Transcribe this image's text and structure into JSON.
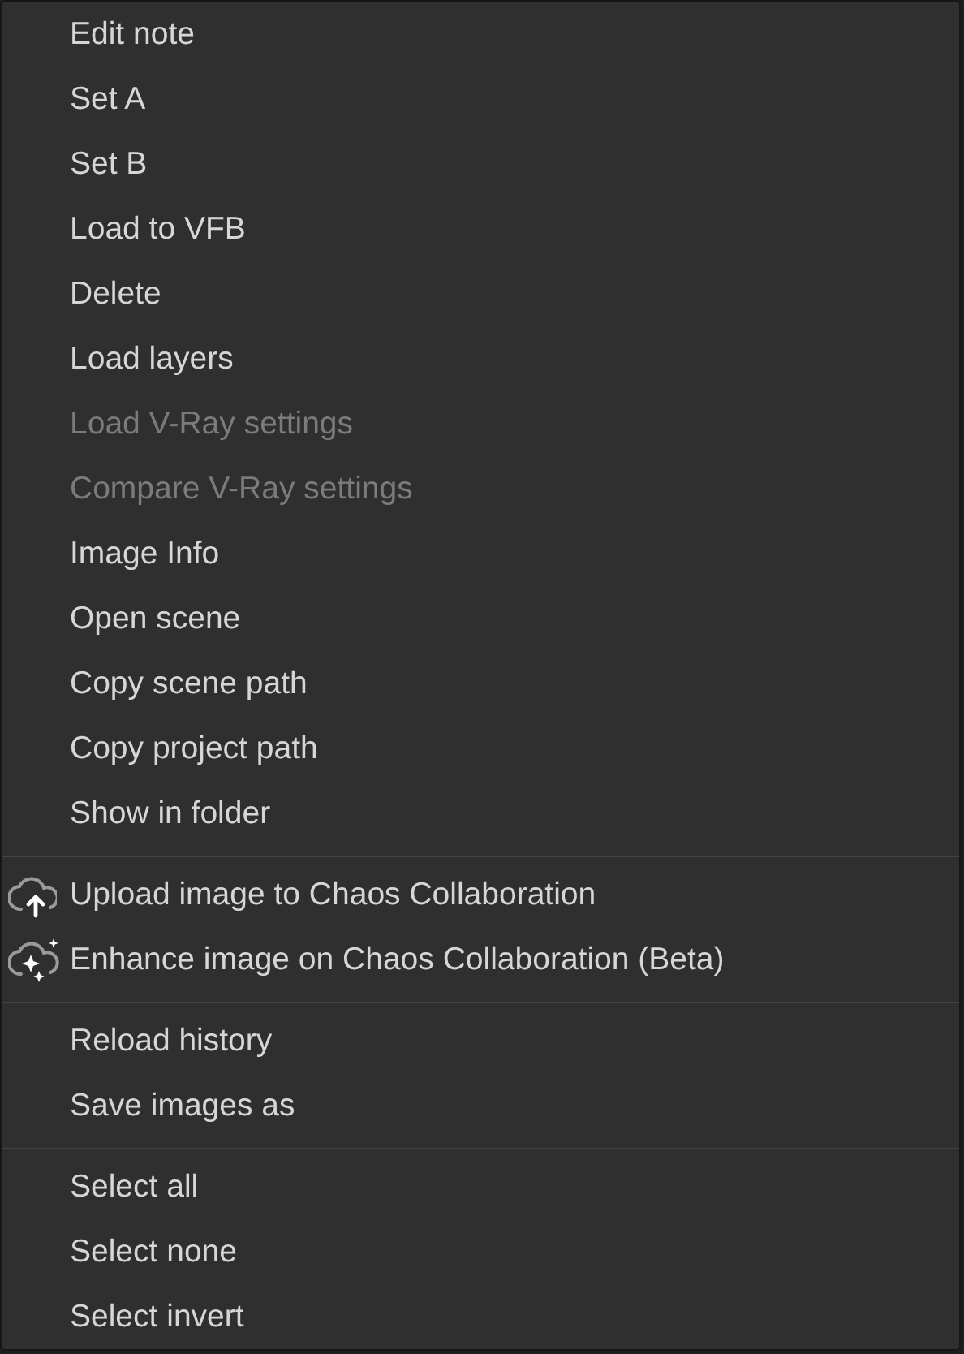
{
  "menu": {
    "sections": [
      {
        "items": [
          {
            "label": "Edit note",
            "disabled": false
          },
          {
            "label": "Set A",
            "disabled": false
          },
          {
            "label": "Set B",
            "disabled": false
          },
          {
            "label": "Load to VFB",
            "disabled": false
          },
          {
            "label": "Delete",
            "disabled": false
          },
          {
            "label": "Load layers",
            "disabled": false
          },
          {
            "label": "Load V-Ray settings",
            "disabled": true
          },
          {
            "label": "Compare V-Ray settings",
            "disabled": true
          },
          {
            "label": "Image Info",
            "disabled": false
          },
          {
            "label": "Open scene",
            "disabled": false
          },
          {
            "label": "Copy scene path",
            "disabled": false
          },
          {
            "label": "Copy project path",
            "disabled": false
          },
          {
            "label": "Show in folder",
            "disabled": false
          }
        ]
      },
      {
        "items": [
          {
            "label": "Upload image to Chaos Collaboration",
            "disabled": false,
            "kind": "upload"
          },
          {
            "label": "Enhance image on Chaos Collaboration (Beta)",
            "disabled": false,
            "kind": "enhance"
          }
        ]
      },
      {
        "items": [
          {
            "label": "Reload history",
            "disabled": false
          },
          {
            "label": "Save images as",
            "disabled": false
          }
        ]
      },
      {
        "items": [
          {
            "label": "Select all",
            "disabled": false
          },
          {
            "label": "Select none",
            "disabled": false
          },
          {
            "label": "Select invert",
            "disabled": false
          }
        ]
      }
    ]
  }
}
